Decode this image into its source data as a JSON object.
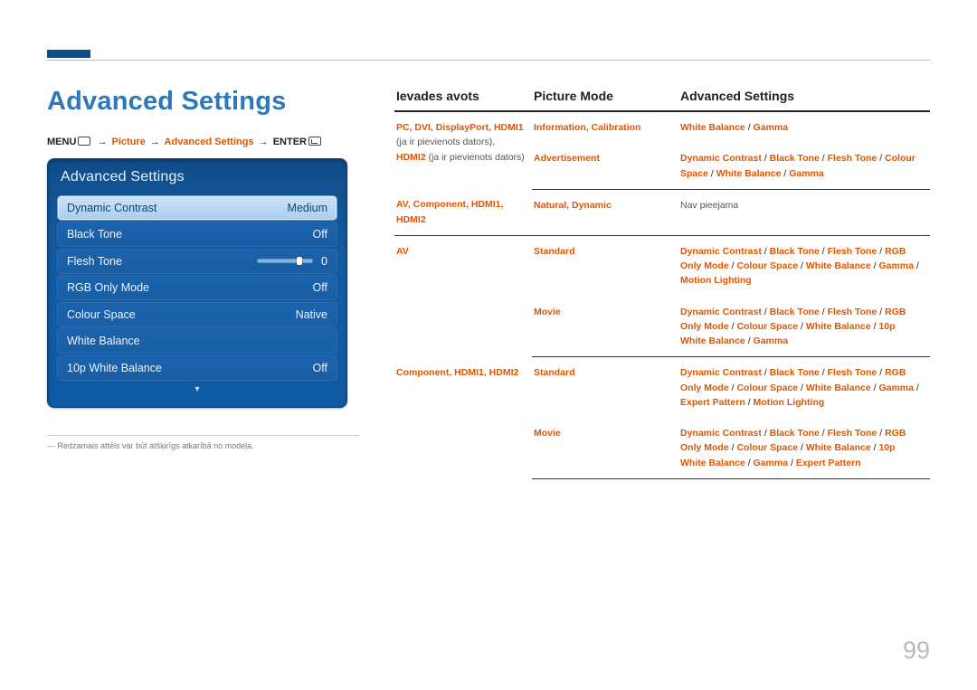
{
  "page_number": "99",
  "title": "Advanced Settings",
  "breadcrumb": {
    "menu": "MENU",
    "step1": "Picture",
    "step2": "Advanced Settings",
    "enter": "ENTER"
  },
  "osd": {
    "title": "Advanced Settings",
    "rows": [
      {
        "label": "Dynamic Contrast",
        "value": "Medium",
        "selected": true
      },
      {
        "label": "Black Tone",
        "value": "Off"
      },
      {
        "label": "Flesh Tone",
        "value": "0",
        "slider": true
      },
      {
        "label": "RGB Only Mode",
        "value": "Off"
      },
      {
        "label": "Colour Space",
        "value": "Native"
      },
      {
        "label": "White Balance",
        "value": ""
      },
      {
        "label": "10p White Balance",
        "value": "Off"
      }
    ]
  },
  "footnote": "Redzamais attēls var būt atšķirīgs atkarībā no modeļa.",
  "table": {
    "headers": {
      "c1": "Ievades avots",
      "c2": "Picture Mode",
      "c3": "Advanced Settings"
    },
    "groups": [
      {
        "c1_hl": "PC, DVI, DisplayPort, HDMI1",
        "c1_plain1": "(ja ir pievienots dators),",
        "c1_hl2": "HDMI2",
        "c1_plain2": "(ja ir pievienots dators)",
        "rows": [
          {
            "c2": "Information, Calibration",
            "c3": [
              [
                "White Balance"
              ],
              [
                "Gamma"
              ]
            ]
          },
          {
            "c2": "Advertisement",
            "c3": [
              [
                "Dynamic Contrast"
              ],
              [
                "Black Tone"
              ],
              [
                "Flesh Tone"
              ],
              [
                "Colour Space"
              ],
              [
                "White Balance"
              ],
              [
                "Gamma"
              ]
            ]
          }
        ]
      },
      {
        "c1_hl": "AV, Component, HDMI1, HDMI2",
        "rows": [
          {
            "c2": "Natural, Dynamic",
            "c3_plain": "Nav pieejama"
          }
        ]
      },
      {
        "c1_hl": "AV",
        "rows": [
          {
            "c2": "Standard",
            "c3": [
              [
                "Dynamic Contrast"
              ],
              [
                "Black Tone"
              ],
              [
                "Flesh Tone"
              ],
              [
                "RGB Only Mode"
              ],
              [
                "Colour Space"
              ],
              [
                "White Balance"
              ],
              [
                "Gamma"
              ],
              [
                "Motion Lighting"
              ]
            ]
          },
          {
            "c2": "Movie",
            "c3": [
              [
                "Dynamic Contrast"
              ],
              [
                "Black Tone"
              ],
              [
                "Flesh Tone"
              ],
              [
                "RGB Only Mode"
              ],
              [
                "Colour Space"
              ],
              [
                "White Balance"
              ],
              [
                "10p White Balance"
              ],
              [
                "Gamma"
              ]
            ]
          }
        ]
      },
      {
        "c1_hl": "Component, HDMI1, HDMI2",
        "rows": [
          {
            "c2": "Standard",
            "c3": [
              [
                "Dynamic Contrast"
              ],
              [
                "Black Tone"
              ],
              [
                "Flesh Tone"
              ],
              [
                "RGB Only Mode"
              ],
              [
                "Colour Space"
              ],
              [
                "White Balance"
              ],
              [
                "Gamma"
              ],
              [
                "Expert Pattern"
              ],
              [
                "Motion Lighting"
              ]
            ]
          },
          {
            "c2": "Movie",
            "c3": [
              [
                "Dynamic Contrast"
              ],
              [
                "Black Tone"
              ],
              [
                "Flesh Tone"
              ],
              [
                "RGB Only Mode"
              ],
              [
                "Colour Space"
              ],
              [
                "White Balance"
              ],
              [
                "10p White Balance"
              ],
              [
                "Gamma"
              ],
              [
                "Expert Pattern"
              ]
            ]
          }
        ]
      }
    ]
  }
}
